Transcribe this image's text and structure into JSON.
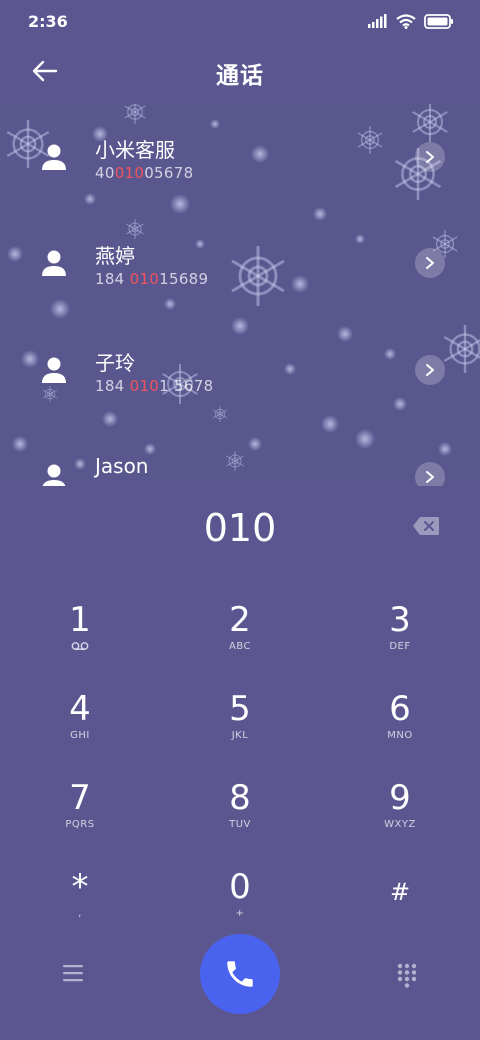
{
  "status_bar": {
    "time": "2:36"
  },
  "header": {
    "title": "通话"
  },
  "contacts": [
    {
      "name": "小米客服",
      "num_pre": "40",
      "num_hl": "010",
      "num_post": "05678"
    },
    {
      "name": "燕婷",
      "num_pre": "184 ",
      "num_hl": "010",
      "num_post": "15689"
    },
    {
      "name": "子玲",
      "num_pre": "184 ",
      "num_hl": "010",
      "num_post": "1 5678"
    },
    {
      "name": "Jason",
      "num_pre": "",
      "num_hl": "",
      "num_post": ""
    }
  ],
  "dialer": {
    "input": "010",
    "keys": [
      {
        "num": "1",
        "sub": ""
      },
      {
        "num": "2",
        "sub": "ABC"
      },
      {
        "num": "3",
        "sub": "DEF"
      },
      {
        "num": "4",
        "sub": "GHI"
      },
      {
        "num": "5",
        "sub": "JKL"
      },
      {
        "num": "6",
        "sub": "MNO"
      },
      {
        "num": "7",
        "sub": "PQRS"
      },
      {
        "num": "8",
        "sub": "TUV"
      },
      {
        "num": "9",
        "sub": "WXYZ"
      },
      {
        "num": "*",
        "sub": ","
      },
      {
        "num": "0",
        "sub": "+"
      },
      {
        "num": "#",
        "sub": ""
      }
    ]
  },
  "colors": {
    "background": "#5b5590",
    "highlight": "#f0525e",
    "call_button": "#4a63ee"
  },
  "icons": {
    "back": "arrow-left-icon",
    "avatar": "person-icon",
    "chevron": "chevron-right-icon",
    "backspace": "backspace-icon",
    "voicemail": "voicemail-icon",
    "menu": "hamburger-menu-icon",
    "call": "phone-icon",
    "keypad": "dialpad-icon"
  }
}
